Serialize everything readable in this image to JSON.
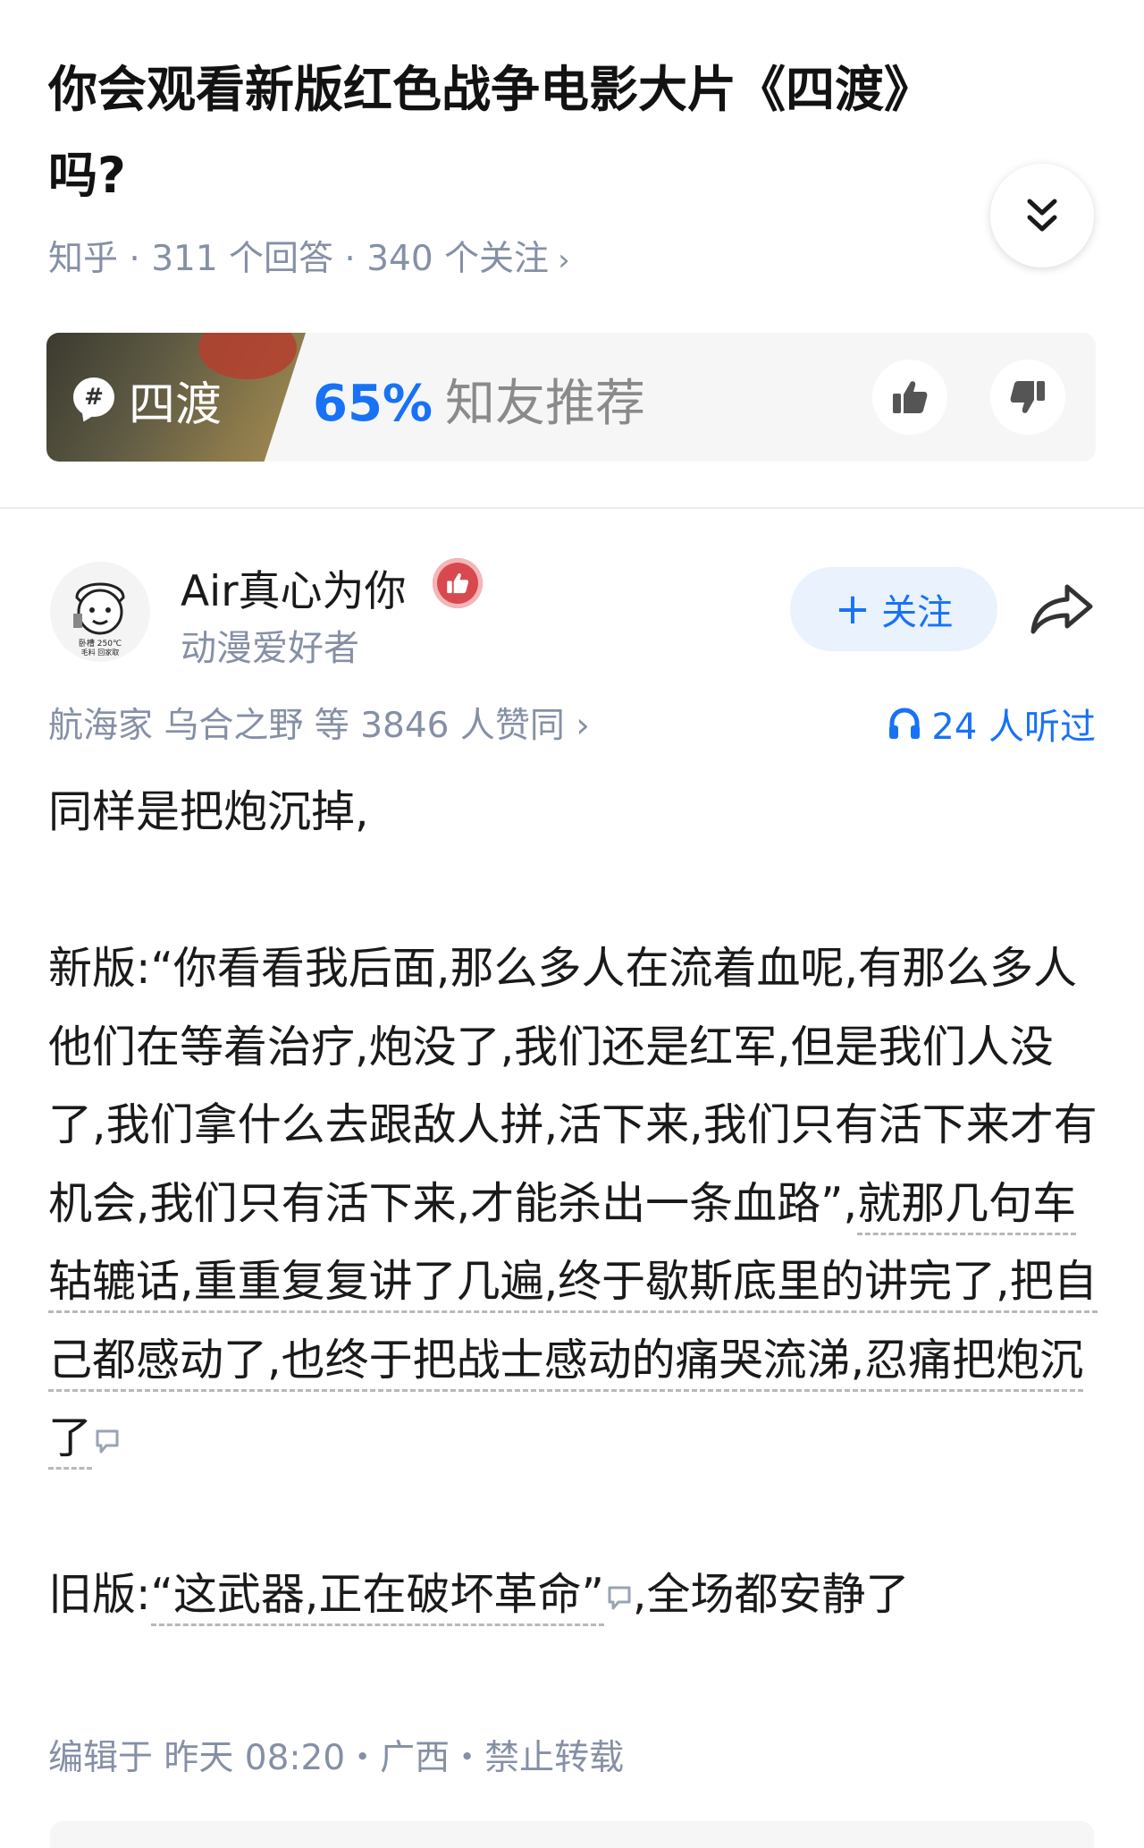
{
  "question": {
    "title": "你会观看新版红色战争电影大片《四渡》吗?",
    "meta": "知乎 · 311 个回答 · 340 个关注",
    "meta_chevron": "›",
    "expand_icon": "double-chevron-down-icon"
  },
  "topic_card": {
    "tag_name": "四渡",
    "hash": "#",
    "rating_percent": "65%",
    "rating_label": "知友推荐"
  },
  "author": {
    "name": "Air真心为你",
    "bio": "动漫爱好者",
    "follow_label": "关注",
    "follow_plus": "+",
    "avatar_text_1": "卧槽 250℃",
    "avatar_text_2": "毛料 回家取"
  },
  "stats": {
    "voters": "航海家 乌合之野 等 3846 人赞同",
    "voters_chevron": "›",
    "listened": "24 人听过"
  },
  "content": {
    "p1": "同样是把炮沉掉,",
    "p2_plain": "新版:“你看看我后面,那么多人在流着血呢,有那么多人他们在等着治疗,炮没了,我们还是红军,但是我们人没了,我们拿什么去跟敌人拼,活下来,我们只有活下来才有机会,我们只有活下来,才能杀出一条血路”,",
    "p2_underlined": "就那几句车轱辘话,重重复复讲了几遍,终于歇斯底里的讲完了,把自己都感动了,也终于把战士感动的痛哭流涕,忍痛把炮沉了",
    "p3_prefix": "旧版:",
    "p3_underlined": "“这武器,正在破坏革命”",
    "p3_suffix": ",全场都安静了"
  },
  "footer": {
    "edit_info": "编辑于 昨天 08:20・广西・禁止转载"
  },
  "colors": {
    "accent": "#1772f6",
    "meta_gray": "#8590a6",
    "badge_red": "#d8484f"
  }
}
